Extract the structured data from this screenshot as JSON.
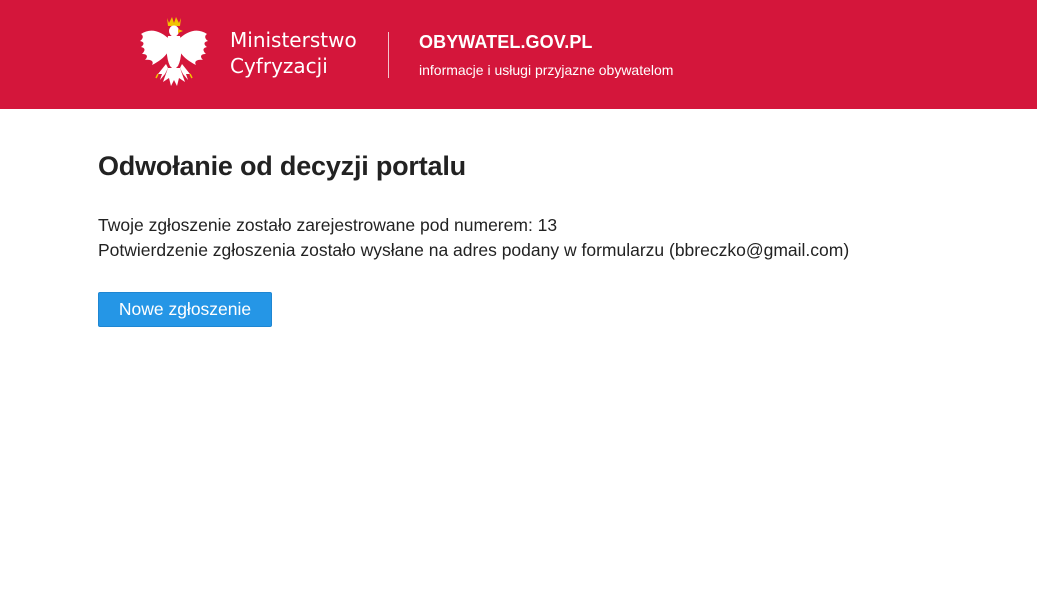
{
  "header": {
    "ministry_line1": "Ministerstwo",
    "ministry_line2": "Cyfryzacji",
    "portal_name": "OBYWATEL.GOV.PL",
    "portal_tagline": "informacje i usługi przyjazne obywatelom",
    "logo_icon": "polish-eagle-emblem",
    "background_color": "#d4163b"
  },
  "main": {
    "title": "Odwołanie od decyzji portalu",
    "message_line1": "Twoje zgłoszenie zostało zarejestrowane pod numerem: 13",
    "message_line2": "Potwierdzenie zgłoszenia zostało wysłane na adres podany w formularzu (bbreczko@gmail.com)",
    "new_request_label": "Nowe zgłoszenie",
    "button_color": "#2596e6"
  }
}
